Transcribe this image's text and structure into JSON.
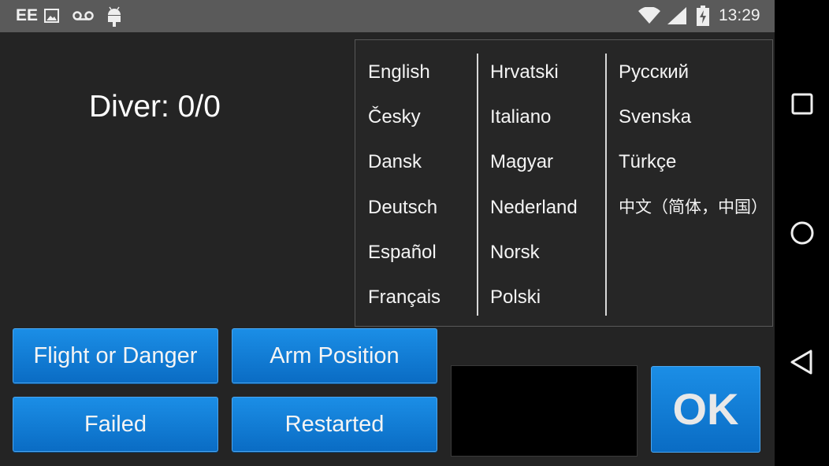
{
  "status_bar": {
    "carrier": "EE",
    "time": "13:29",
    "icons": [
      "image-icon",
      "voicemail-icon",
      "android-debug-icon",
      "wifi-icon",
      "signal-icon",
      "battery-charging-icon"
    ]
  },
  "main": {
    "diver_label": "Diver: 0/0"
  },
  "buttons": {
    "flight_or_danger": "Flight or Danger",
    "arm_position": "Arm Position",
    "failed": "Failed",
    "restarted": "Restarted",
    "ok": "OK"
  },
  "language_menu": {
    "columns": [
      [
        "English",
        "Česky",
        "Dansk",
        "Deutsch",
        "Español",
        "Français"
      ],
      [
        "Hrvatski",
        "Italiano",
        "Magyar",
        "Nederland",
        "Norsk",
        "Polski"
      ],
      [
        "Русский",
        "Svenska",
        "Türkçe",
        "中文（简体，中国）"
      ]
    ]
  },
  "nav_bar": {
    "icons": [
      "recents-square-icon",
      "home-circle-icon",
      "back-triangle-icon"
    ]
  }
}
